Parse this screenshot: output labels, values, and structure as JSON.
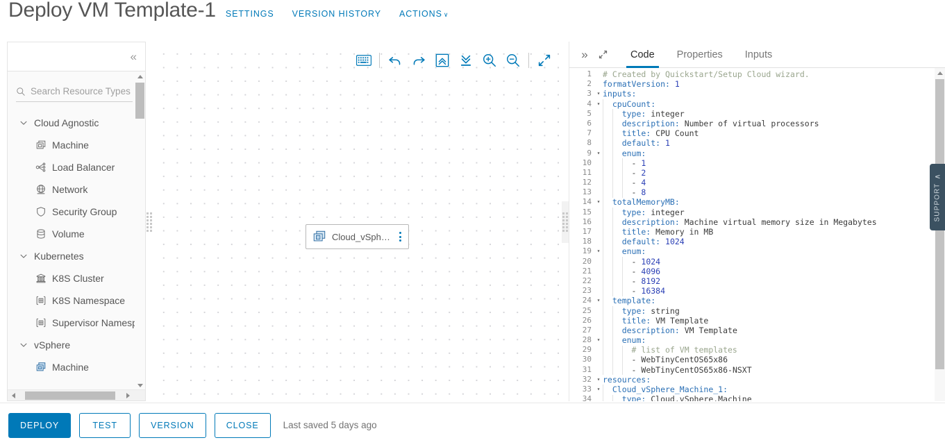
{
  "header": {
    "title": "Deploy VM Template-1",
    "links": [
      {
        "label": "SETTINGS",
        "name": "settings"
      },
      {
        "label": "VERSION HISTORY",
        "name": "version-history"
      },
      {
        "label": "ACTIONS",
        "name": "actions",
        "caret": "∨"
      }
    ]
  },
  "palette": {
    "collapse_icon": "«",
    "search": {
      "placeholder": "Search Resource Types",
      "value": ""
    },
    "tree": [
      {
        "type": "group",
        "label": "Cloud Agnostic",
        "expanded": true,
        "icon": "chevron-down-icon"
      },
      {
        "type": "item",
        "label": "Machine",
        "icon": "machine-icon"
      },
      {
        "type": "item",
        "label": "Load Balancer",
        "icon": "load-balancer-icon"
      },
      {
        "type": "item",
        "label": "Network",
        "icon": "network-icon"
      },
      {
        "type": "item",
        "label": "Security Group",
        "icon": "shield-icon"
      },
      {
        "type": "item",
        "label": "Volume",
        "icon": "volume-icon"
      },
      {
        "type": "group",
        "label": "Kubernetes",
        "expanded": true,
        "icon": "chevron-down-icon"
      },
      {
        "type": "item",
        "label": "K8S Cluster",
        "icon": "cluster-icon"
      },
      {
        "type": "item",
        "label": "K8S Namespace",
        "icon": "namespace-icon"
      },
      {
        "type": "item",
        "label": "Supervisor Namesp",
        "icon": "namespace-icon"
      },
      {
        "type": "group",
        "label": "vSphere",
        "expanded": true,
        "icon": "chevron-down-icon"
      },
      {
        "type": "item",
        "label": "Machine",
        "icon": "vsphere-machine-icon"
      }
    ]
  },
  "canvas": {
    "toolbar": [
      {
        "name": "keyboard-shortcuts-button",
        "icon": "keyboard-icon"
      },
      {
        "name": "separator-1",
        "icon": "separator"
      },
      {
        "name": "undo-button",
        "icon": "undo-icon"
      },
      {
        "name": "redo-button",
        "icon": "redo-icon"
      },
      {
        "name": "collapse-all-button",
        "icon": "collapse-all-icon"
      },
      {
        "name": "expand-all-button",
        "icon": "expand-all-icon"
      },
      {
        "name": "zoom-in-button",
        "icon": "zoom-in-icon"
      },
      {
        "name": "zoom-out-button",
        "icon": "zoom-out-icon"
      },
      {
        "name": "separator-2",
        "icon": "separator"
      },
      {
        "name": "fit-to-screen-button",
        "icon": "fit-screen-icon"
      }
    ],
    "node": {
      "label": "Cloud_vSpher…",
      "icon": "vsphere-machine-icon",
      "menu_icon": "kebab-menu-icon"
    }
  },
  "code_pane": {
    "expand_icon": "»",
    "maximize_icon": "maximize-icon",
    "tabs": [
      {
        "label": "Code",
        "active": true
      },
      {
        "label": "Properties",
        "active": false
      },
      {
        "label": "Inputs",
        "active": false
      }
    ],
    "lines": [
      {
        "n": 1,
        "fold": "",
        "indent": 0,
        "tokens": [
          {
            "t": "com",
            "s": "# Created by Quickstart/Setup Cloud wizard."
          }
        ]
      },
      {
        "n": 2,
        "fold": "",
        "indent": 0,
        "tokens": [
          {
            "t": "key",
            "s": "formatVersion:"
          },
          {
            "t": "pl",
            "s": " "
          },
          {
            "t": "num",
            "s": "1"
          }
        ]
      },
      {
        "n": 3,
        "fold": "▾",
        "indent": 0,
        "tokens": [
          {
            "t": "key",
            "s": "inputs:"
          }
        ]
      },
      {
        "n": 4,
        "fold": "▾",
        "indent": 1,
        "tokens": [
          {
            "t": "key",
            "s": "  cpuCount:"
          }
        ]
      },
      {
        "n": 5,
        "fold": "",
        "indent": 2,
        "tokens": [
          {
            "t": "key",
            "s": "    type:"
          },
          {
            "t": "str",
            "s": " integer"
          }
        ]
      },
      {
        "n": 6,
        "fold": "",
        "indent": 2,
        "tokens": [
          {
            "t": "key",
            "s": "    description:"
          },
          {
            "t": "str",
            "s": " Number of virtual processors"
          }
        ]
      },
      {
        "n": 7,
        "fold": "",
        "indent": 2,
        "tokens": [
          {
            "t": "key",
            "s": "    title:"
          },
          {
            "t": "str",
            "s": " CPU Count"
          }
        ]
      },
      {
        "n": 8,
        "fold": "",
        "indent": 2,
        "tokens": [
          {
            "t": "key",
            "s": "    default:"
          },
          {
            "t": "pl",
            "s": " "
          },
          {
            "t": "num",
            "s": "1"
          }
        ]
      },
      {
        "n": 9,
        "fold": "▾",
        "indent": 2,
        "tokens": [
          {
            "t": "key",
            "s": "    enum:"
          }
        ]
      },
      {
        "n": 10,
        "fold": "",
        "indent": 3,
        "tokens": [
          {
            "t": "pl",
            "s": "      - "
          },
          {
            "t": "num",
            "s": "1"
          }
        ]
      },
      {
        "n": 11,
        "fold": "",
        "indent": 3,
        "tokens": [
          {
            "t": "pl",
            "s": "      - "
          },
          {
            "t": "num",
            "s": "2"
          }
        ]
      },
      {
        "n": 12,
        "fold": "",
        "indent": 3,
        "tokens": [
          {
            "t": "pl",
            "s": "      - "
          },
          {
            "t": "num",
            "s": "4"
          }
        ]
      },
      {
        "n": 13,
        "fold": "",
        "indent": 3,
        "tokens": [
          {
            "t": "pl",
            "s": "      - "
          },
          {
            "t": "num",
            "s": "8"
          }
        ]
      },
      {
        "n": 14,
        "fold": "▾",
        "indent": 1,
        "tokens": [
          {
            "t": "key",
            "s": "  totalMemoryMB:"
          }
        ]
      },
      {
        "n": 15,
        "fold": "",
        "indent": 2,
        "tokens": [
          {
            "t": "key",
            "s": "    type:"
          },
          {
            "t": "str",
            "s": " integer"
          }
        ]
      },
      {
        "n": 16,
        "fold": "",
        "indent": 2,
        "tokens": [
          {
            "t": "key",
            "s": "    description:"
          },
          {
            "t": "str",
            "s": " Machine virtual memory size in Megabytes"
          }
        ]
      },
      {
        "n": 17,
        "fold": "",
        "indent": 2,
        "tokens": [
          {
            "t": "key",
            "s": "    title:"
          },
          {
            "t": "str",
            "s": " Memory in MB"
          }
        ]
      },
      {
        "n": 18,
        "fold": "",
        "indent": 2,
        "tokens": [
          {
            "t": "key",
            "s": "    default:"
          },
          {
            "t": "pl",
            "s": " "
          },
          {
            "t": "num",
            "s": "1024"
          }
        ]
      },
      {
        "n": 19,
        "fold": "▾",
        "indent": 2,
        "tokens": [
          {
            "t": "key",
            "s": "    enum:"
          }
        ]
      },
      {
        "n": 20,
        "fold": "",
        "indent": 3,
        "tokens": [
          {
            "t": "pl",
            "s": "      - "
          },
          {
            "t": "num",
            "s": "1024"
          }
        ]
      },
      {
        "n": 21,
        "fold": "",
        "indent": 3,
        "tokens": [
          {
            "t": "pl",
            "s": "      - "
          },
          {
            "t": "num",
            "s": "4096"
          }
        ]
      },
      {
        "n": 22,
        "fold": "",
        "indent": 3,
        "tokens": [
          {
            "t": "pl",
            "s": "      - "
          },
          {
            "t": "num",
            "s": "8192"
          }
        ]
      },
      {
        "n": 23,
        "fold": "",
        "indent": 3,
        "tokens": [
          {
            "t": "pl",
            "s": "      - "
          },
          {
            "t": "num",
            "s": "16384"
          }
        ]
      },
      {
        "n": 24,
        "fold": "▾",
        "indent": 1,
        "tokens": [
          {
            "t": "key",
            "s": "  template:"
          }
        ]
      },
      {
        "n": 25,
        "fold": "",
        "indent": 2,
        "tokens": [
          {
            "t": "key",
            "s": "    type:"
          },
          {
            "t": "str",
            "s": " string"
          }
        ]
      },
      {
        "n": 26,
        "fold": "",
        "indent": 2,
        "tokens": [
          {
            "t": "key",
            "s": "    title:"
          },
          {
            "t": "str",
            "s": " VM Template"
          }
        ]
      },
      {
        "n": 27,
        "fold": "",
        "indent": 2,
        "tokens": [
          {
            "t": "key",
            "s": "    description:"
          },
          {
            "t": "str",
            "s": " VM Template"
          }
        ]
      },
      {
        "n": 28,
        "fold": "▾",
        "indent": 2,
        "tokens": [
          {
            "t": "key",
            "s": "    enum:"
          }
        ]
      },
      {
        "n": 29,
        "fold": "",
        "indent": 3,
        "tokens": [
          {
            "t": "com",
            "s": "      # list of VM templates"
          }
        ]
      },
      {
        "n": 30,
        "fold": "",
        "indent": 3,
        "tokens": [
          {
            "t": "pl",
            "s": "      - "
          },
          {
            "t": "str",
            "s": "WebTinyCentOS65x86"
          }
        ]
      },
      {
        "n": 31,
        "fold": "",
        "indent": 3,
        "tokens": [
          {
            "t": "pl",
            "s": "      - "
          },
          {
            "t": "str",
            "s": "WebTinyCentOS65x86-NSXT"
          }
        ]
      },
      {
        "n": 32,
        "fold": "▾",
        "indent": 0,
        "tokens": [
          {
            "t": "key",
            "s": "resources:"
          }
        ]
      },
      {
        "n": 33,
        "fold": "▾",
        "indent": 1,
        "tokens": [
          {
            "t": "key",
            "s": "  Cloud_vSphere_Machine_1:"
          }
        ]
      },
      {
        "n": 34,
        "fold": "",
        "indent": 2,
        "tokens": [
          {
            "t": "key",
            "s": "    type:"
          },
          {
            "t": "str",
            "s": " Cloud.vSphere.Machine"
          }
        ]
      }
    ]
  },
  "support": {
    "label": "SUPPORT",
    "icon": "chevron-left-icon"
  },
  "footer": {
    "buttons": [
      {
        "label": "DEPLOY",
        "name": "deploy-button",
        "style": "primary"
      },
      {
        "label": "TEST",
        "name": "test-button",
        "style": "outline"
      },
      {
        "label": "VERSION",
        "name": "version-button",
        "style": "outline"
      },
      {
        "label": "CLOSE",
        "name": "close-button",
        "style": "outline"
      }
    ],
    "status": "Last saved 5 days ago"
  },
  "colors": {
    "accent": "#0079b8",
    "text": "#565656",
    "support_bg": "#3b5161"
  }
}
